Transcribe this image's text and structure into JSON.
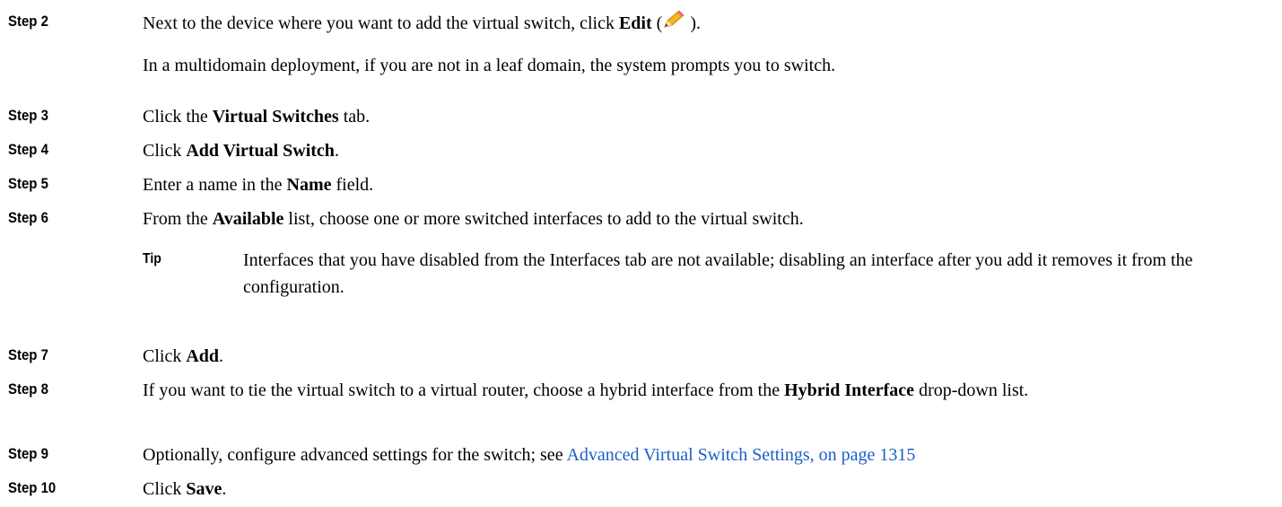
{
  "steps": [
    {
      "label": "Step 2",
      "pre": "Next to the device where you want to add the virtual switch, click ",
      "bold": "Edit",
      "post_open": " (",
      "post_close": " ).",
      "icon": "pencil-edit-icon",
      "note": "In a multidomain deployment, if you are not in a leaf domain, the system prompts you to switch."
    },
    {
      "label": "Step 3",
      "pre": "Click the ",
      "bold": "Virtual Switches",
      "post": " tab."
    },
    {
      "label": "Step 4",
      "pre": "Click ",
      "bold": "Add Virtual Switch",
      "post": "."
    },
    {
      "label": "Step 5",
      "pre": "Enter a name in the ",
      "bold": "Name",
      "post": " field."
    },
    {
      "label": "Step 6",
      "pre": "From the ",
      "bold": "Available",
      "post": " list, choose one or more switched interfaces to add to the virtual switch.",
      "tip_label": "Tip",
      "tip_text": "Interfaces that you have disabled from the Interfaces tab are not available; disabling an interface after you add it removes it from the configuration."
    },
    {
      "label": "Step 7",
      "pre": "Click ",
      "bold": "Add",
      "post": "."
    },
    {
      "label": "Step 8",
      "pre": "If you want to tie the virtual switch to a virtual router, choose a hybrid interface from the ",
      "bold": "Hybrid Interface",
      "post": " drop-down list."
    },
    {
      "label": "Step 9",
      "pre": "Optionally, configure advanced settings for the switch; see ",
      "link": "Advanced Virtual Switch Settings, on page 1315"
    },
    {
      "label": "Step 10",
      "pre": "Click ",
      "bold": "Save",
      "post": "."
    }
  ],
  "colors": {
    "link": "#1a5fc6",
    "text": "#000000"
  }
}
